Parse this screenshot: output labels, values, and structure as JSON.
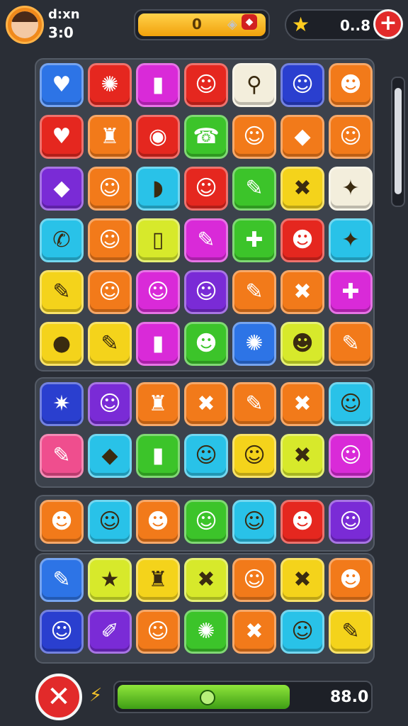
{
  "player": {
    "name": "d:xn",
    "score": "3:0",
    "avatar_icon": "player-avatar-face"
  },
  "coins": {
    "value": "0",
    "gem_icon": "gem-icon",
    "red_gem_icon": "red-gem-icon"
  },
  "stars": {
    "value": "0..8",
    "icon": "star-icon"
  },
  "add_button_label": "+",
  "bottom": {
    "close_label": "✕",
    "energy_icon": "lightning-icon",
    "progress_value": "88.0",
    "progress_fraction": 0.68
  },
  "colors": {
    "blue": "#2d74e6",
    "red": "#e5271f",
    "magenta": "#d92ad8",
    "white": "#f3eedc",
    "navy": "#2a3fcf",
    "orange": "#f27a1a",
    "green": "#3cc42a",
    "yellow": "#f4d31b",
    "lime": "#d7e92b",
    "purple": "#7a2bd6",
    "cyan": "#29c2e8",
    "pink": "#ef4e8e",
    "dark": "#2b3440"
  },
  "boards": [
    {
      "name": "board-main",
      "rows": [
        [
          {
            "bg": "blue",
            "icon": "♥"
          },
          {
            "bg": "red",
            "icon": "✺"
          },
          {
            "bg": "magenta",
            "icon": "▮"
          },
          {
            "bg": "red",
            "icon": "☺"
          },
          {
            "bg": "white",
            "icon": "⚲"
          },
          {
            "bg": "navy",
            "icon": "☺"
          },
          {
            "bg": "orange",
            "icon": "☻"
          }
        ],
        [
          {
            "bg": "red",
            "icon": "♥"
          },
          {
            "bg": "orange",
            "icon": "♜"
          },
          {
            "bg": "red",
            "icon": "◉"
          },
          {
            "bg": "green",
            "icon": "☎"
          },
          {
            "bg": "orange",
            "icon": "☺"
          },
          {
            "bg": "orange",
            "icon": "◆"
          },
          {
            "bg": "orange",
            "icon": "☺"
          }
        ],
        [
          {
            "bg": "purple",
            "icon": "◆"
          },
          {
            "bg": "orange",
            "icon": "☺"
          },
          {
            "bg": "cyan",
            "icon": "◗"
          },
          {
            "bg": "red",
            "icon": "☺"
          },
          {
            "bg": "green",
            "icon": "✎"
          },
          {
            "bg": "yellow",
            "icon": "✖"
          },
          {
            "bg": "white",
            "icon": "✦"
          }
        ],
        [
          {
            "bg": "cyan",
            "icon": "✆"
          },
          {
            "bg": "orange",
            "icon": "☺"
          },
          {
            "bg": "lime",
            "icon": "▯"
          },
          {
            "bg": "magenta",
            "icon": "✎"
          },
          {
            "bg": "green",
            "icon": "✚"
          },
          {
            "bg": "red",
            "icon": "☻"
          },
          {
            "bg": "cyan",
            "icon": "✦"
          }
        ],
        [
          {
            "bg": "yellow",
            "icon": "✎"
          },
          {
            "bg": "orange",
            "icon": "☺"
          },
          {
            "bg": "magenta",
            "icon": "☺"
          },
          {
            "bg": "purple",
            "icon": "☺"
          },
          {
            "bg": "orange",
            "icon": "✎"
          },
          {
            "bg": "orange",
            "icon": "✖"
          },
          {
            "bg": "magenta",
            "icon": "✚"
          }
        ],
        [
          {
            "bg": "yellow",
            "icon": "●"
          },
          {
            "bg": "yellow",
            "icon": "✎"
          },
          {
            "bg": "magenta",
            "icon": "▮"
          },
          {
            "bg": "green",
            "icon": "☻"
          },
          {
            "bg": "blue",
            "icon": "✺"
          },
          {
            "bg": "lime",
            "icon": "☻"
          },
          {
            "bg": "orange",
            "icon": "✎"
          }
        ]
      ]
    },
    {
      "name": "board-middle",
      "rows": [
        [
          {
            "bg": "navy",
            "icon": "✷"
          },
          {
            "bg": "purple",
            "icon": "☺"
          },
          {
            "bg": "orange",
            "icon": "♜"
          },
          {
            "bg": "orange",
            "icon": "✖"
          },
          {
            "bg": "orange",
            "icon": "✎"
          },
          {
            "bg": "orange",
            "icon": "✖"
          },
          {
            "bg": "cyan",
            "icon": "☺"
          }
        ],
        [
          {
            "bg": "pink",
            "icon": "✎"
          },
          {
            "bg": "cyan",
            "icon": "◆"
          },
          {
            "bg": "green",
            "icon": "▮"
          },
          {
            "bg": "cyan",
            "icon": "☺"
          },
          {
            "bg": "yellow",
            "icon": "☺"
          },
          {
            "bg": "lime",
            "icon": "✖"
          },
          {
            "bg": "magenta",
            "icon": "☺"
          }
        ]
      ]
    },
    {
      "name": "board-row",
      "rows": [
        [
          {
            "bg": "orange",
            "icon": "☻"
          },
          {
            "bg": "cyan",
            "icon": "☺"
          },
          {
            "bg": "orange",
            "icon": "☻"
          },
          {
            "bg": "green",
            "icon": "☺"
          },
          {
            "bg": "cyan",
            "icon": "☺"
          },
          {
            "bg": "red",
            "icon": "☻"
          },
          {
            "bg": "purple",
            "icon": "☺"
          }
        ]
      ]
    },
    {
      "name": "board-bottom",
      "rows": [
        [
          {
            "bg": "blue",
            "icon": "✎"
          },
          {
            "bg": "lime",
            "icon": "★"
          },
          {
            "bg": "yellow",
            "icon": "♜"
          },
          {
            "bg": "lime",
            "icon": "✖"
          },
          {
            "bg": "orange",
            "icon": "☺"
          },
          {
            "bg": "yellow",
            "icon": "✖"
          },
          {
            "bg": "orange",
            "icon": "☻"
          }
        ],
        [
          {
            "bg": "navy",
            "icon": "☺"
          },
          {
            "bg": "purple",
            "icon": "✐"
          },
          {
            "bg": "orange",
            "icon": "☺"
          },
          {
            "bg": "green",
            "icon": "✺"
          },
          {
            "bg": "orange",
            "icon": "✖"
          },
          {
            "bg": "cyan",
            "icon": "☺"
          },
          {
            "bg": "yellow",
            "icon": "✎"
          }
        ]
      ]
    }
  ]
}
